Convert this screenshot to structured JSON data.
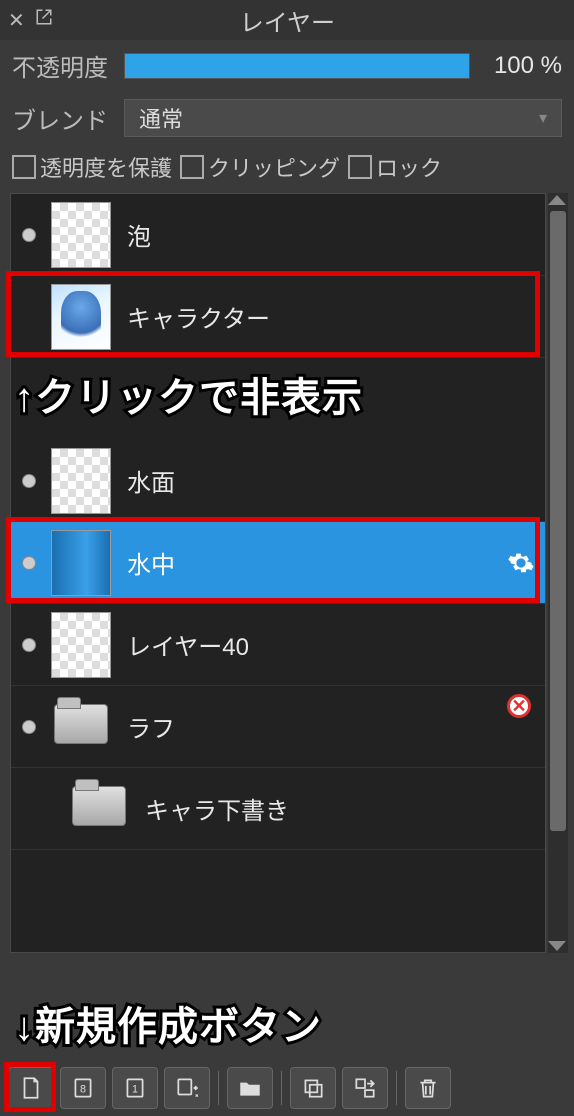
{
  "panel": {
    "title": "レイヤー"
  },
  "opacity": {
    "label": "不透明度",
    "value_text": "100 %",
    "fill_pct": 100
  },
  "blend": {
    "label": "ブレンド",
    "mode": "通常"
  },
  "checks": {
    "protect_alpha": "透明度を保護",
    "clipping": "クリッピング",
    "lock": "ロック"
  },
  "layers": [
    {
      "name": "泡",
      "visible": true,
      "thumb": "checker",
      "selected": false,
      "highlighted": false,
      "indent": 0,
      "type": "layer"
    },
    {
      "name": "キャラクター",
      "visible": false,
      "thumb": "character",
      "selected": false,
      "highlighted": true,
      "indent": 0,
      "type": "layer"
    },
    {
      "name": "水面",
      "visible": true,
      "thumb": "checker",
      "selected": false,
      "highlighted": false,
      "indent": 0,
      "type": "layer"
    },
    {
      "name": "水中",
      "visible": true,
      "thumb": "blue",
      "selected": true,
      "highlighted": true,
      "indent": 0,
      "type": "layer",
      "gear": true
    },
    {
      "name": "レイヤー40",
      "visible": true,
      "thumb": "checker",
      "selected": false,
      "highlighted": false,
      "indent": 0,
      "type": "layer"
    },
    {
      "name": "ラフ",
      "visible": true,
      "thumb": "folder",
      "selected": false,
      "highlighted": false,
      "indent": 0,
      "type": "folder",
      "badge": "disabled"
    },
    {
      "name": "キャラ下書き",
      "visible": false,
      "thumb": "folder",
      "selected": false,
      "highlighted": false,
      "indent": 1,
      "type": "folder"
    }
  ],
  "annotations": {
    "hide_hint": "↑クリックで非表示",
    "new_hint": "↓新規作成ボタン"
  },
  "toolbar": {
    "new_layer": "new-layer",
    "new_8bit": "8",
    "new_1bit": "1",
    "add_special": "add-menu",
    "new_folder": "folder",
    "duplicate": "duplicate",
    "merge": "merge",
    "delete": "delete"
  }
}
